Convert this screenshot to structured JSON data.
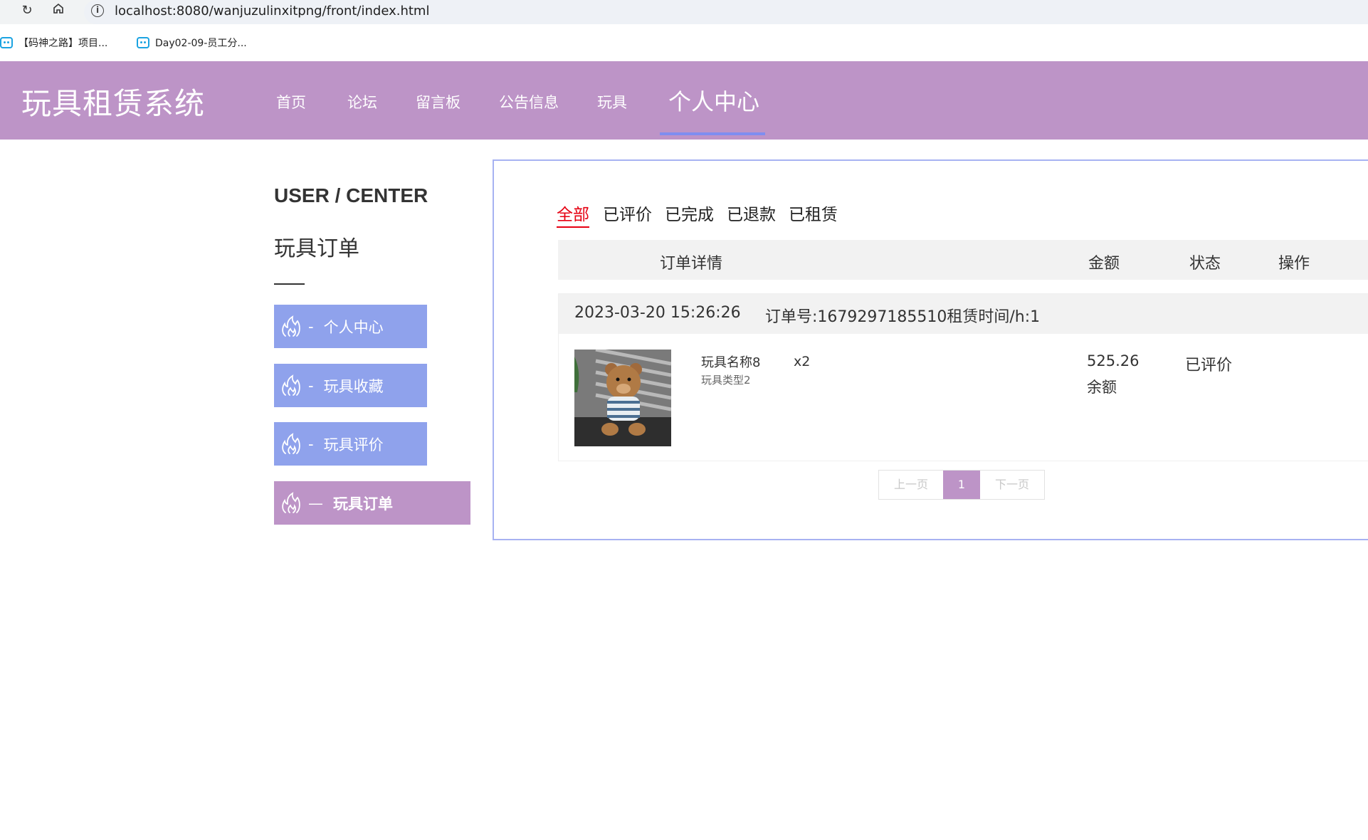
{
  "browser": {
    "url": "localhost:8080/wanjuzulinxitpng/front/index.html",
    "bookmarks": [
      "【码神之路】项目...",
      "Day02-09-员工分..."
    ]
  },
  "header": {
    "title": "玩具租赁系统",
    "nav": [
      "首页",
      "论坛",
      "留言板",
      "公告信息",
      "玩具",
      "个人中心"
    ]
  },
  "sidebar": {
    "heading": "USER / CENTER",
    "subtitle": "玩具订单",
    "items": [
      {
        "dash": "-",
        "label": "个人中心"
      },
      {
        "dash": "-",
        "label": "玩具收藏"
      },
      {
        "dash": "-",
        "label": "玩具评价"
      },
      {
        "dash": "—",
        "label": "玩具订单"
      }
    ]
  },
  "orders": {
    "filters": [
      "全部",
      "已评价",
      "已完成",
      "已退款",
      "已租赁"
    ],
    "columns": [
      "订单详情",
      "金额",
      "状态",
      "操作"
    ],
    "list": [
      {
        "date": "2023-03-20 15:26:26",
        "order_no": "订单号:1679297185510租赁时间/h:1",
        "item_name": "玩具名称8",
        "item_type": "玩具类型2",
        "qty": "x2",
        "amount": "525.26",
        "pay_method": "余额",
        "status": "已评价"
      }
    ],
    "pager": {
      "prev": "上一页",
      "current": "1",
      "next": "下一页"
    }
  },
  "colors": {
    "header_bg": "#bd94c7",
    "sidebar_button": "#8fa2ec",
    "active_filter": "#e60012"
  }
}
